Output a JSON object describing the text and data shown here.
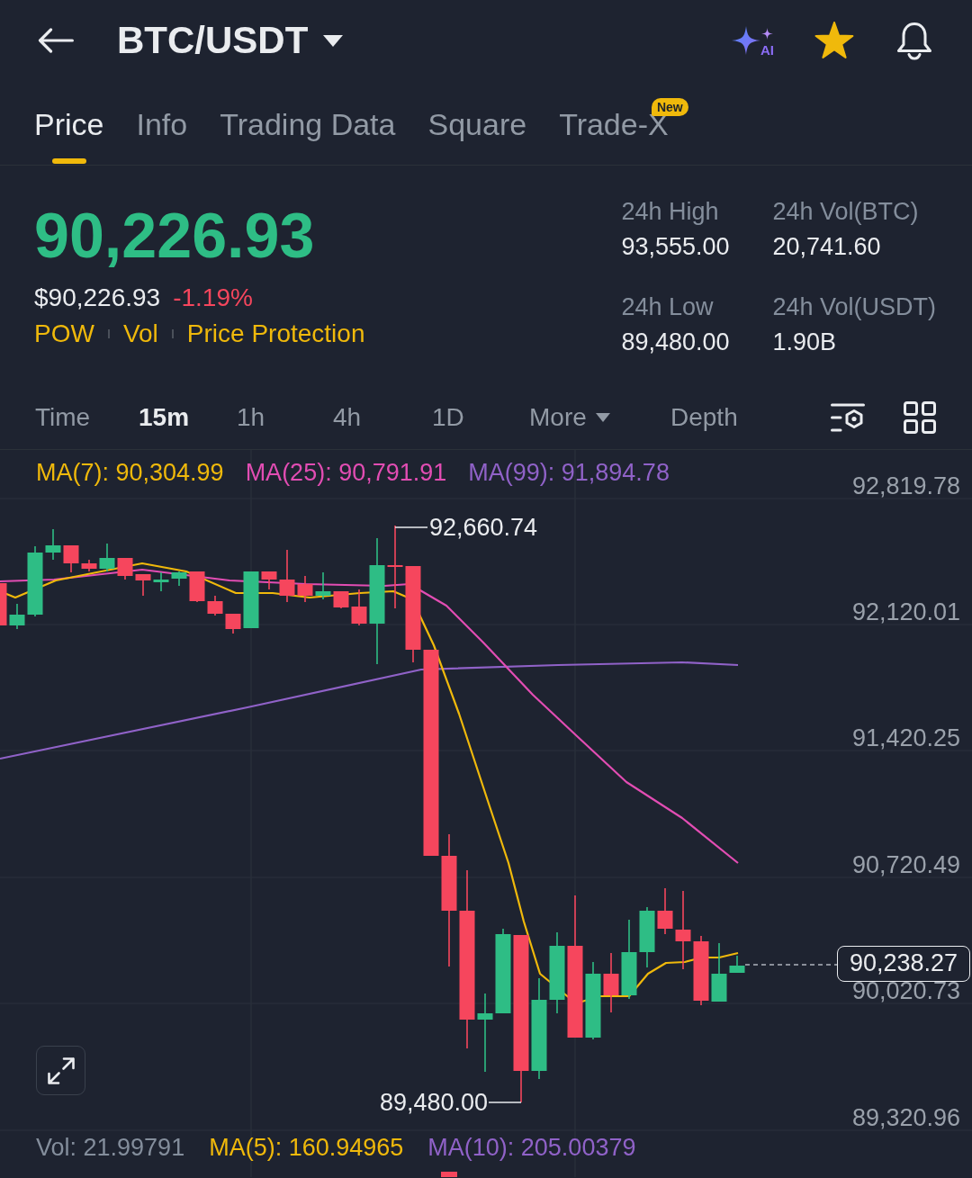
{
  "header": {
    "title": "BTC/USDT",
    "ai_label": "AI",
    "favorite": true
  },
  "tabs": [
    {
      "label": "Price",
      "selected": true
    },
    {
      "label": "Info",
      "selected": false
    },
    {
      "label": "Trading Data",
      "selected": false
    },
    {
      "label": "Square",
      "selected": false
    },
    {
      "label": "Trade-X",
      "selected": false,
      "badge": "New"
    }
  ],
  "ticker": {
    "last_price": "90,226.93",
    "fiat_price": "$90,226.93",
    "change": "-1.19%",
    "tags": [
      "POW",
      "Vol",
      "Price Protection"
    ]
  },
  "stats": [
    {
      "label": "24h High",
      "value": "93,555.00"
    },
    {
      "label": "24h Vol(BTC)",
      "value": "20,741.60"
    },
    {
      "label": "24h Low",
      "value": "89,480.00"
    },
    {
      "label": "24h Vol(USDT)",
      "value": "1.90B"
    }
  ],
  "intervals": [
    {
      "label": "Time",
      "kind": "option",
      "selected": false
    },
    {
      "label": "15m",
      "kind": "option",
      "selected": true
    },
    {
      "label": "1h",
      "kind": "option",
      "selected": false
    },
    {
      "label": "4h",
      "kind": "option",
      "selected": false
    },
    {
      "label": "1D",
      "kind": "option",
      "selected": false
    },
    {
      "label": "More",
      "kind": "dropdown",
      "selected": false
    },
    {
      "label": "Depth",
      "kind": "option",
      "selected": false
    }
  ],
  "chart": {
    "indicators": [
      {
        "label": "MA(7): 90,304.99",
        "color": "#f0b90b"
      },
      {
        "label": "MA(25): 90,791.91",
        "color": "#e24db3"
      },
      {
        "label": "MA(99): 91,894.78",
        "color": "#9062c8"
      }
    ],
    "price_axis": [
      "92,819.78",
      "92,120.01",
      "91,420.25",
      "90,720.49",
      "90,020.73",
      "89,320.96"
    ],
    "high_label": "92,660.74",
    "low_label": "89,480.00",
    "last_price_label": "90,238.27"
  },
  "volume": {
    "indicators": [
      {
        "label": "Vol: 21.99791",
        "color": "#848e9c"
      },
      {
        "label": "MA(5): 160.94965",
        "color": "#f0b90b"
      },
      {
        "label": "MA(10): 205.00379",
        "color": "#9062c8"
      }
    ]
  }
}
